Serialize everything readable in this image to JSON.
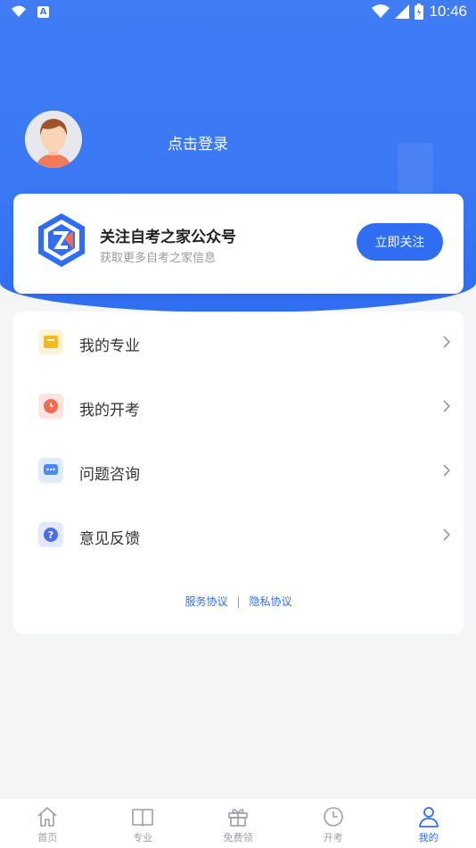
{
  "status_bar": {
    "time": "10:46",
    "a_label": "A"
  },
  "profile": {
    "login_text": "点击登录"
  },
  "follow_card": {
    "title": "关注自考之家公众号",
    "subtitle": "获取更多自考之家信息",
    "button_label": "立即关注"
  },
  "menu": {
    "items": [
      {
        "label": "我的专业",
        "icon": "folder-icon",
        "icon_bg": "#fdf3d6",
        "icon_color": "#f5b920"
      },
      {
        "label": "我的开考",
        "icon": "clock-icon",
        "icon_bg": "#fde4e0",
        "icon_color": "#f26a4f"
      },
      {
        "label": "问题咨询",
        "icon": "chat-icon",
        "icon_bg": "#e0ecfd",
        "icon_color": "#4a8af4"
      },
      {
        "label": "意见反馈",
        "icon": "question-icon",
        "icon_bg": "#e3e9fb",
        "icon_color": "#4a6cf0"
      }
    ]
  },
  "agreements": {
    "service": "服务协议",
    "separator": "|",
    "privacy": "隐私协议"
  },
  "tabs": [
    {
      "label": "首页",
      "icon": "home-icon",
      "active": false
    },
    {
      "label": "专业",
      "icon": "book-icon",
      "active": false
    },
    {
      "label": "免费领",
      "icon": "gift-icon",
      "active": false
    },
    {
      "label": "开考",
      "icon": "clock-icon",
      "active": false
    },
    {
      "label": "我的",
      "icon": "user-icon",
      "active": true
    }
  ],
  "colors": {
    "primary": "#2f6ef2",
    "header_bg": "#3f7cf6",
    "inactive_tab": "#9aa0a8"
  }
}
